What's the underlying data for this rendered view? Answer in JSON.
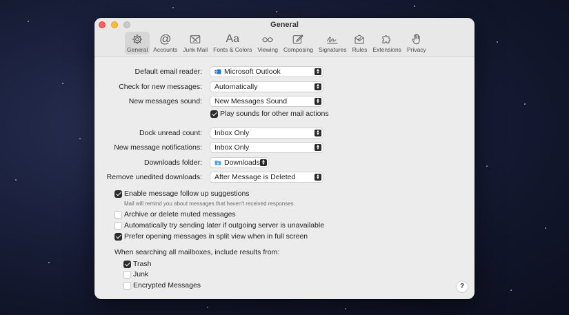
{
  "window": {
    "title": "General"
  },
  "toolbar": [
    {
      "label": "General",
      "icon": "gear-icon",
      "active": true
    },
    {
      "label": "Accounts",
      "icon": "at-icon"
    },
    {
      "label": "Junk Mail",
      "icon": "junk-mail-icon"
    },
    {
      "label": "Fonts & Colors",
      "icon": "fonts-icon"
    },
    {
      "label": "Viewing",
      "icon": "glasses-icon"
    },
    {
      "label": "Composing",
      "icon": "compose-icon"
    },
    {
      "label": "Signatures",
      "icon": "signature-icon"
    },
    {
      "label": "Rules",
      "icon": "rules-icon"
    },
    {
      "label": "Extensions",
      "icon": "puzzle-icon"
    },
    {
      "label": "Privacy",
      "icon": "hand-icon"
    }
  ],
  "settings": {
    "default_email_reader": {
      "label": "Default email reader:",
      "value": "Microsoft Outlook"
    },
    "check_messages": {
      "label": "Check for new messages:",
      "value": "Automatically"
    },
    "messages_sound": {
      "label": "New messages sound:",
      "value": "New Messages Sound"
    },
    "play_sounds": {
      "label": "Play sounds for other mail actions",
      "checked": true
    },
    "dock_unread": {
      "label": "Dock unread count:",
      "value": "Inbox Only"
    },
    "notifications": {
      "label": "New message notifications:",
      "value": "Inbox Only"
    },
    "downloads_folder": {
      "label": "Downloads folder:",
      "value": "Downloads"
    },
    "remove_downloads": {
      "label": "Remove unedited downloads:",
      "value": "After Message is Deleted"
    }
  },
  "checkboxes": {
    "follow_up": {
      "label": "Enable message follow up suggestions",
      "checked": true,
      "note": "Mail will remind you about messages that haven't received responses."
    },
    "archive_muted": {
      "label": "Archive or delete muted messages",
      "checked": false
    },
    "send_later": {
      "label": "Automatically try sending later if outgoing server is unavailable",
      "checked": false
    },
    "split_view": {
      "label": "Prefer opening messages in split view when in full screen",
      "checked": true
    }
  },
  "search": {
    "heading": "When searching all mailboxes, include results from:",
    "trash": {
      "label": "Trash",
      "checked": true
    },
    "junk": {
      "label": "Junk",
      "checked": false
    },
    "encrypted": {
      "label": "Encrypted Messages",
      "checked": false
    }
  },
  "help": {
    "label": "?"
  },
  "colors": {
    "accent": "#2c2c2c",
    "close": "#fe5f57",
    "minimize": "#febc2e"
  }
}
